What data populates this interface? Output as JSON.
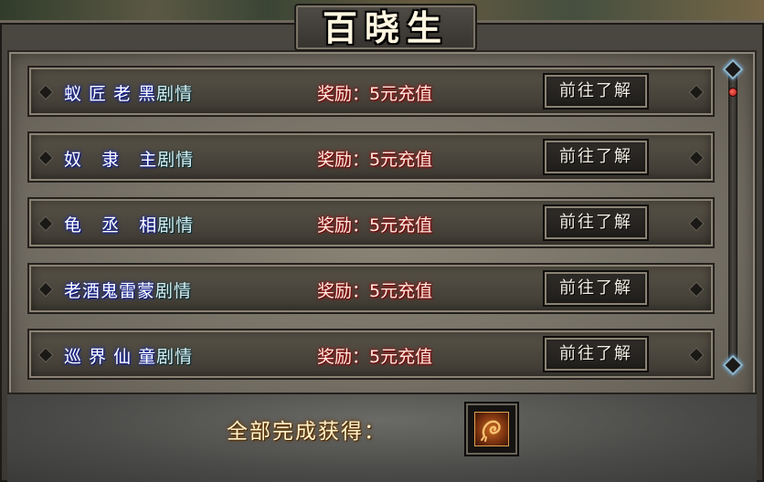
{
  "window": {
    "title": "百晓生"
  },
  "quests": [
    {
      "name": "蚁 匠 老 黑",
      "suffix": "剧情",
      "reward": "奖励：5元充值",
      "button": "前往了解"
    },
    {
      "name": "奴   隶   主",
      "suffix": "剧情",
      "reward": "奖励：5元充值",
      "button": "前往了解"
    },
    {
      "name": "龟   丞   相",
      "suffix": "剧情",
      "reward": "奖励：5元充值",
      "button": "前往了解"
    },
    {
      "name": "老酒鬼雷蒙",
      "suffix": "剧情",
      "reward": "奖励：5元充值",
      "button": "前往了解"
    },
    {
      "name": "巡 界 仙 童",
      "suffix": "剧情",
      "reward": "奖励：5元充值",
      "button": "前往了解"
    }
  ],
  "completion": {
    "label": "全部完成获得：",
    "reward_icon": "dragon-emblem-icon"
  },
  "colors": {
    "quest_name_glow": "#1a2aa8",
    "reward_glow": "#9a1010",
    "completion_glow": "#6a3a00",
    "scroll_accent": "#8fb6c8"
  }
}
